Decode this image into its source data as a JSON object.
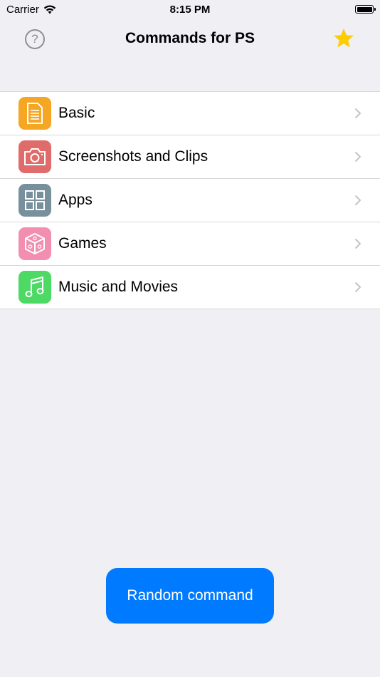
{
  "status_bar": {
    "carrier": "Carrier",
    "time": "8:15 PM"
  },
  "nav": {
    "title": "Commands for PS",
    "help_icon": "question-circle-icon",
    "favorite_icon": "star-icon"
  },
  "categories": [
    {
      "label": "Basic",
      "icon": "document-icon",
      "color": "#f5a623"
    },
    {
      "label": "Screenshots and Clips",
      "icon": "camera-icon",
      "color": "#e06b6b"
    },
    {
      "label": "Apps",
      "icon": "grid-icon",
      "color": "#78909c"
    },
    {
      "label": "Games",
      "icon": "dice-icon",
      "color": "#f28fb1"
    },
    {
      "label": "Music and Movies",
      "icon": "music-note-icon",
      "color": "#4cd964"
    }
  ],
  "random_button": {
    "label": "Random command"
  },
  "colors": {
    "accent": "#007aff",
    "star": "#ffcc00",
    "background": "#efeff4"
  }
}
